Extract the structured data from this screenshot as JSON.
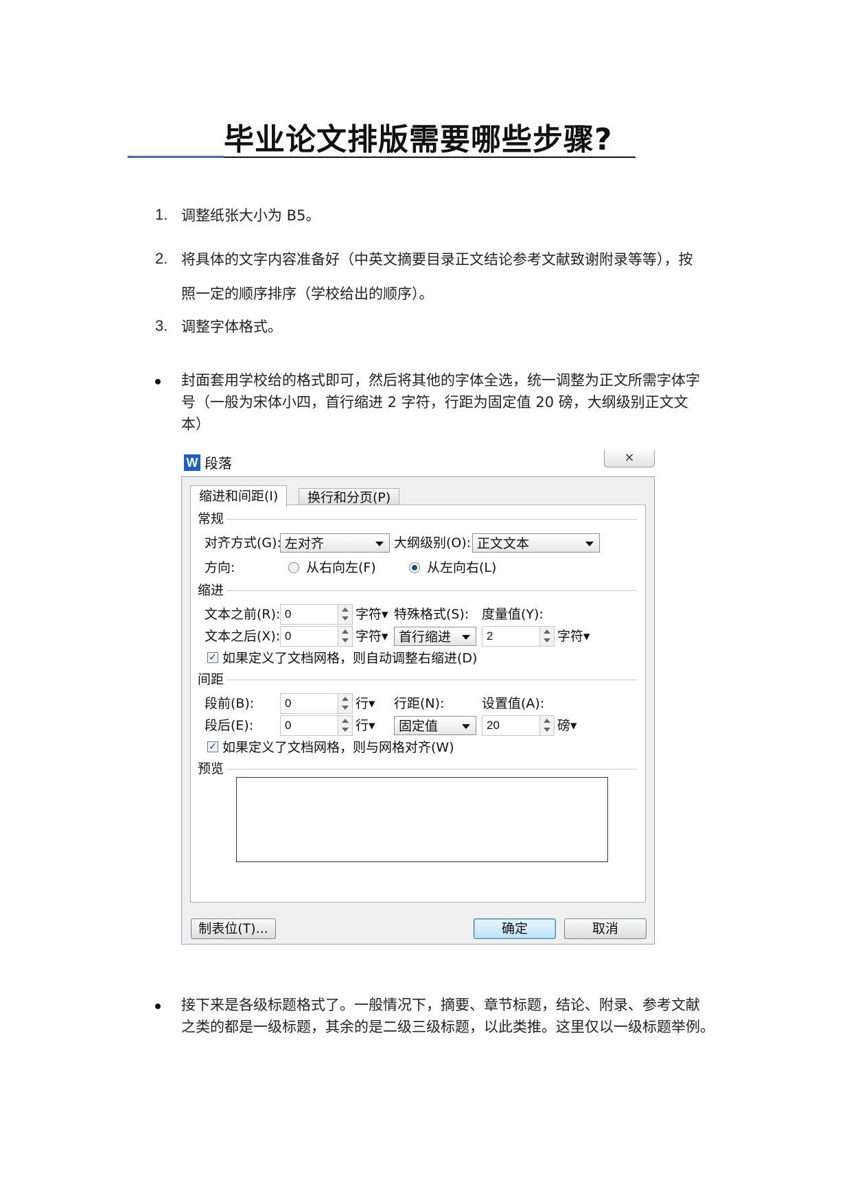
{
  "title": "毕业论文排版需要哪些步骤?",
  "steps": [
    {
      "num": "1.",
      "line1": "调整纸张大小为 B5。",
      "line2": ""
    },
    {
      "num": "2.",
      "line1": "将具体的文字内容准备好（中英文摘要目录正文结论参考文献致谢附录等等），按",
      "line2": "照一定的顺序排序（学校给出的顺序）。"
    },
    {
      "num": "3.",
      "line1": "调整字体格式。",
      "line2": ""
    }
  ],
  "bullets": [
    {
      "line1": "封面套用学校给的格式即可，然后将其他的字体全选，统一调整为正文所需字体字",
      "line2": "号（一般为宋体小四，首行缩进 2 字符，行距为固定值 20 磅，大纲级别正文文",
      "line3": "本）"
    },
    {
      "line1": "接下来是各级标题格式了。一般情况下，摘要、章节标题，结论、附录、参考文献",
      "line2": "之类的都是一级标题，其余的是二级三级标题，以此类推。这里仅以一级标题举例。",
      "line3": ""
    }
  ],
  "dialog": {
    "app_icon": "W",
    "title": "段落",
    "close": "⨯",
    "tabs": [
      "缩进和间距(I)",
      "换行和分页(P)"
    ],
    "general": {
      "section": "常规",
      "align_label": "对齐方式(G):",
      "align_value": "左对齐",
      "outline_label": "大纲级别(O):",
      "outline_value": "正文文本",
      "direction_label": "方向:",
      "rtl_label": "从右向左(F)",
      "ltr_label": "从左向右(L)",
      "selected_direction": "ltr"
    },
    "indent": {
      "section": "缩进",
      "before_label": "文本之前(R):",
      "before_value": "0",
      "before_unit": "字符▾",
      "after_label": "文本之后(X):",
      "after_value": "0",
      "after_unit": "字符▾",
      "special_label": "特殊格式(S):",
      "special_value": "首行缩进",
      "measure_label": "度量值(Y):",
      "measure_value": "2",
      "measure_unit": "字符▾",
      "grid_check": "如果定义了文档网格，则自动调整右缩进(D)",
      "grid_checked": true
    },
    "spacing": {
      "section": "间距",
      "before_label": "段前(B):",
      "before_value": "0",
      "before_unit": "行▾",
      "after_label": "段后(E):",
      "after_value": "0",
      "after_unit": "行▾",
      "line_label": "行距(N):",
      "line_value": "固定值",
      "setting_label": "设置值(A):",
      "setting_value": "20",
      "setting_unit": "磅▾",
      "grid_check": "如果定义了文档网格，则与网格对齐(W)",
      "grid_checked": true
    },
    "preview": {
      "section": "预览"
    },
    "buttons": {
      "tabs": "制表位(T)...",
      "ok": "确定",
      "cancel": "取消"
    }
  }
}
